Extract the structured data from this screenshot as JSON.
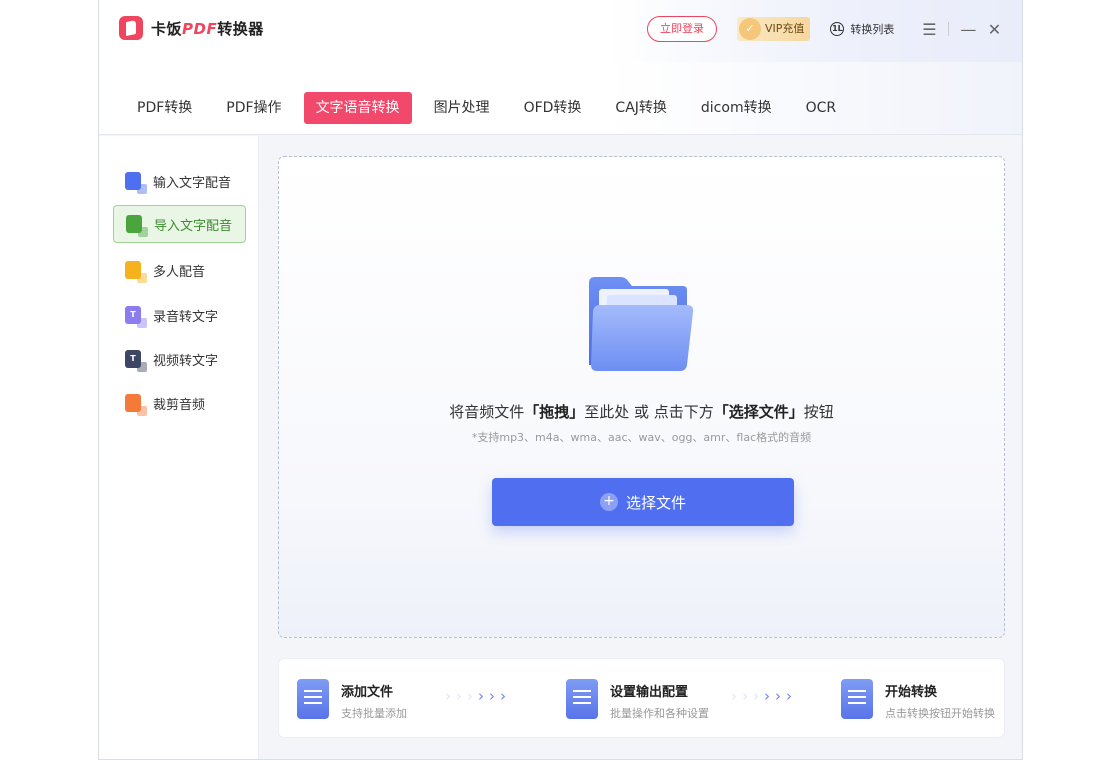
{
  "app": {
    "name_prefix": "卡饭",
    "name_pdf": "PDF",
    "name_suffix": "转换器"
  },
  "titlebar": {
    "login_label": "立即登录",
    "vip_label": "VIP充值",
    "convert_list_label": "转换列表",
    "convert_list_badge": "1L"
  },
  "tabs": [
    {
      "label": "PDF转换",
      "active": false
    },
    {
      "label": "PDF操作",
      "active": false
    },
    {
      "label": "文字语音转换",
      "active": true
    },
    {
      "label": "图片处理",
      "active": false
    },
    {
      "label": "OFD转换",
      "active": false
    },
    {
      "label": "CAJ转换",
      "active": false
    },
    {
      "label": "dicom转换",
      "active": false
    },
    {
      "label": "OCR",
      "active": false
    }
  ],
  "sidebar": {
    "items": [
      {
        "label": "输入文字配音",
        "icon": "microphone-icon",
        "color": "#4f6ef0",
        "active": false
      },
      {
        "label": "导入文字配音",
        "icon": "microphone-import-icon",
        "color": "#4aa63c",
        "active": true
      },
      {
        "label": "多人配音",
        "icon": "multi-voice-icon",
        "color": "#f5b21d",
        "active": false
      },
      {
        "label": "录音转文字",
        "icon": "record-to-text-icon",
        "color": "#8c7cf0",
        "active": false
      },
      {
        "label": "视频转文字",
        "icon": "video-to-text-icon",
        "color": "#3d4663",
        "active": false
      },
      {
        "label": "裁剪音频",
        "icon": "audio-trim-icon",
        "color": "#f47a3a",
        "active": false
      }
    ]
  },
  "dropzone": {
    "title_pre": "将音频文件",
    "title_drag": "「拖拽」",
    "title_mid": "至此处 或 点击下方",
    "title_select": "「选择文件」",
    "title_post": "按钮",
    "hint": "*支持mp3、m4a、wma、aac、wav、ogg、amr、flac格式的音频",
    "button_label": "选择文件"
  },
  "steps": [
    {
      "title": "添加文件",
      "desc": "支持批量添加"
    },
    {
      "title": "设置输出配置",
      "desc": "批量操作和各种设置"
    },
    {
      "title": "开始转换",
      "desc": "点击转换按钮开始转换"
    }
  ],
  "colors": {
    "brand": "#f0455e",
    "active_tab": "#f2486b",
    "primary_button": "#4f6ef0",
    "active_sidebar_bg": "#e9f6e6"
  }
}
